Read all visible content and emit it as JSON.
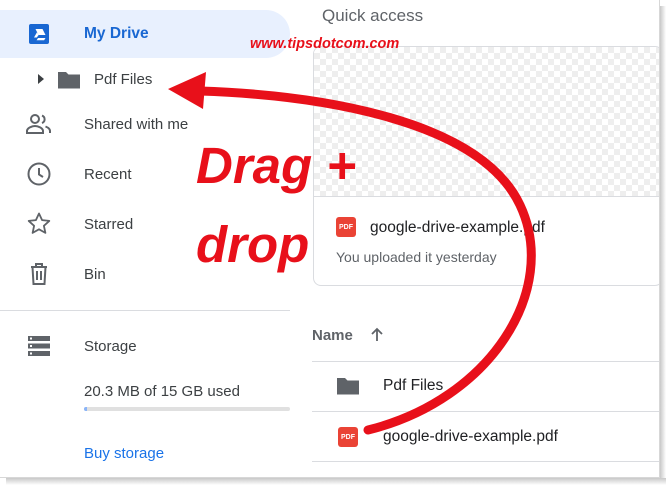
{
  "sidebar": {
    "my_drive": "My Drive",
    "pdf_folder": "Pdf Files",
    "items": [
      {
        "label": "Shared with me",
        "icon": "people-icon"
      },
      {
        "label": "Recent",
        "icon": "clock-icon"
      },
      {
        "label": "Starred",
        "icon": "star-icon"
      },
      {
        "label": "Bin",
        "icon": "trash-icon"
      }
    ],
    "storage": {
      "label": "Storage",
      "icon": "storage-icon",
      "used_text": "20.3 MB of 15 GB used",
      "used_fraction": 0.0014,
      "buy_label": "Buy storage"
    }
  },
  "main": {
    "quick_access_title": "Quick access",
    "quick_card": {
      "file_name": "google-drive-example.pdf",
      "subtitle": "You uploaded it yesterday",
      "file_icon": "pdf-icon"
    },
    "list": {
      "column_name": "Name",
      "sort_icon": "arrow-up-icon",
      "rows": [
        {
          "name": "Pdf Files",
          "icon": "folder-icon"
        },
        {
          "name": "google-drive-example.pdf",
          "icon": "pdf-icon"
        }
      ]
    },
    "pdf_badge_text": "PDF"
  },
  "overlay": {
    "watermark": "www.tipsdotcom.com",
    "line1": "Drag +",
    "line2": "drop"
  },
  "colors": {
    "accent": "#1967d2",
    "selected_bg": "#e8f0fe",
    "annotation": "#e8101a",
    "pdf_red": "#ea4335"
  }
}
